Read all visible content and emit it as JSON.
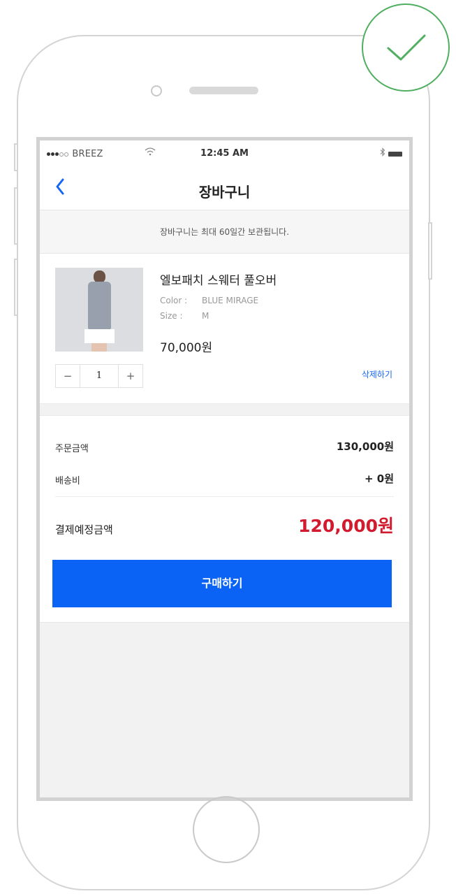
{
  "status_bar": {
    "carrier": "BREEZ",
    "time": "12:45 AM"
  },
  "nav": {
    "title": "장바구니"
  },
  "notice": "장바구니는 최대 60일간 보관됩니다.",
  "cart_item": {
    "name": "엘보패치 스웨터 풀오버",
    "color_label": "Color :",
    "color_value": "BLUE MIRAGE",
    "size_label": "Size :",
    "size_value": "M",
    "price": "70,000원",
    "quantity": "1",
    "minus": "−",
    "plus": "+",
    "delete_label": "삭제하기"
  },
  "summary": {
    "order_amount_label": "주문금액",
    "order_amount": "130,000원",
    "shipping_label": "배송비",
    "shipping": "+ 0원",
    "total_label": "결제예정금액",
    "total": "120,000원",
    "buy_label": "구매하기"
  },
  "colors": {
    "accent": "#0b63f6",
    "total_red": "#d21b2f",
    "check_green": "#4fae5f"
  }
}
